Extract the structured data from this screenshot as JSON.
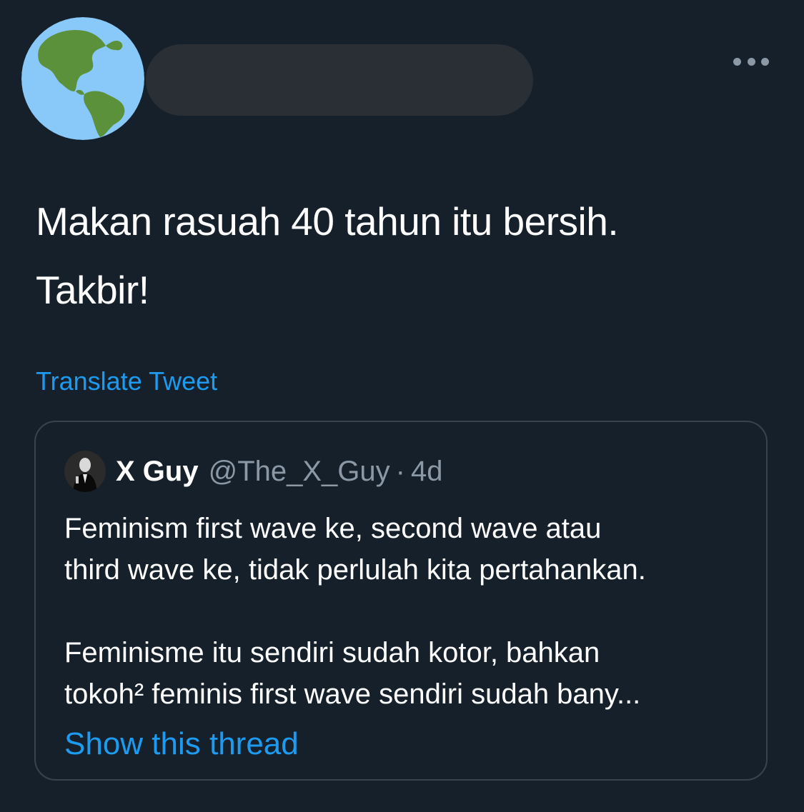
{
  "header": {
    "avatar_icon": "globe-americas-icon",
    "more_icon": "more-options-icon"
  },
  "tweet": {
    "text": "Makan rasuah 40 tahun itu bersih.\nTakbir!",
    "translate_label": "Translate Tweet"
  },
  "quoted_tweet": {
    "name": "X Guy",
    "handle": "@The_X_Guy",
    "separator": "·",
    "time": "4d",
    "paragraphs": [
      "Feminism first wave ke, second wave atau\nthird wave ke, tidak perlulah kita pertahankan.",
      "Feminisme itu sendiri sudah kotor, bahkan\ntokoh² feminis first wave sendiri sudah bany..."
    ],
    "show_thread_label": "Show this thread"
  },
  "colors": {
    "background": "#15202b",
    "accent": "#1d9bf0",
    "secondary_text": "#8b98a5",
    "border": "#38444d"
  }
}
